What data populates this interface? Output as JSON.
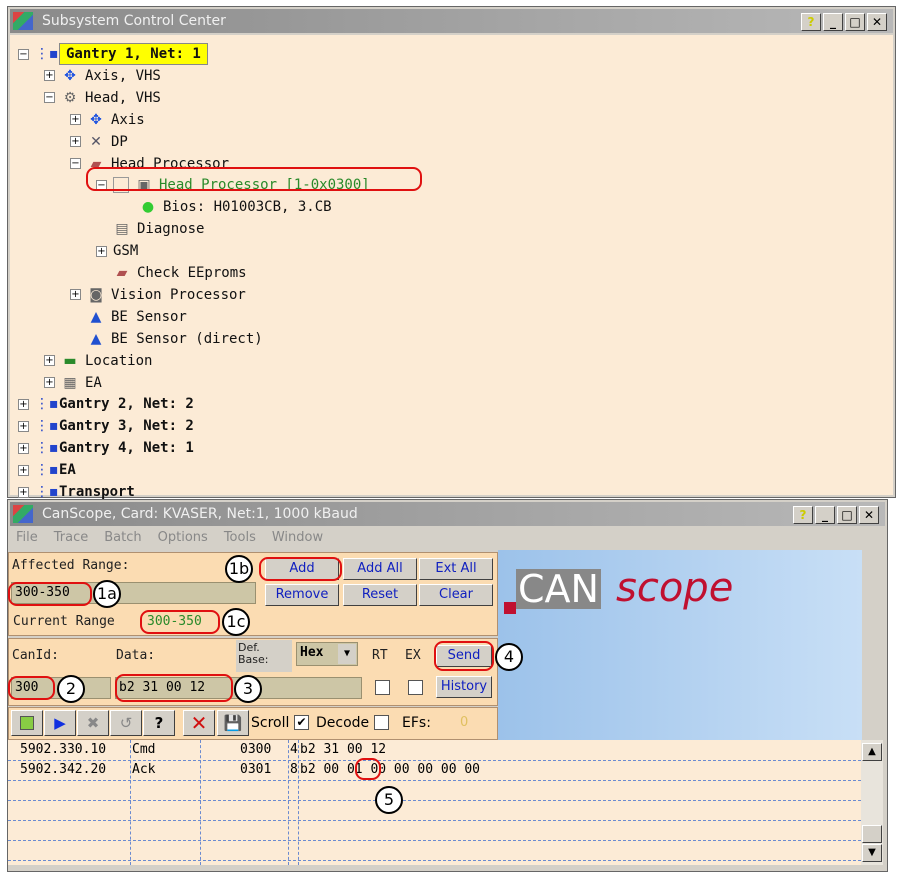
{
  "top_window": {
    "title": "Subsystem Control Center",
    "tree": [
      {
        "label": "Gantry 1, Net: 1",
        "level": 0,
        "expander": "-",
        "icon": "network-icon",
        "style": "highlight"
      },
      {
        "label": "Axis, VHS",
        "level": 1,
        "expander": "+",
        "icon": "axis-icon"
      },
      {
        "label": "Head, VHS",
        "level": 1,
        "expander": "-",
        "icon": "head-icon"
      },
      {
        "label": "Axis",
        "level": 2,
        "expander": "+",
        "icon": "axis-icon"
      },
      {
        "label": "DP",
        "level": 2,
        "expander": "+",
        "icon": "dp-icon"
      },
      {
        "label": "Head Processor",
        "level": 2,
        "expander": "-",
        "icon": "chip-icon"
      },
      {
        "label": "Head Processor [1-0x0300]",
        "level": 3,
        "expander": "-",
        "icon": "processor-icon",
        "style": "green"
      },
      {
        "label": "Bios: H01003CB, 3.CB",
        "level": 4,
        "expander": "",
        "icon": "status-dot-icon"
      },
      {
        "label": "Diagnose",
        "level": 3,
        "expander": "",
        "icon": "diagnose-icon"
      },
      {
        "label": "GSM",
        "level": 3,
        "expander": "+",
        "icon": ""
      },
      {
        "label": "Check EEproms",
        "level": 3,
        "expander": "",
        "icon": "chip-icon"
      },
      {
        "label": "Vision Processor",
        "level": 2,
        "expander": "+",
        "icon": "camera-icon"
      },
      {
        "label": "BE Sensor",
        "level": 2,
        "expander": "",
        "icon": "sensor-icon"
      },
      {
        "label": "BE Sensor (direct)",
        "level": 2,
        "expander": "",
        "icon": "sensor-icon"
      },
      {
        "label": "Location",
        "level": 1,
        "expander": "+",
        "icon": "location-icon"
      },
      {
        "label": "EA",
        "level": 1,
        "expander": "+",
        "icon": "grid-icon"
      },
      {
        "label": "Gantry 2, Net: 2",
        "level": 0,
        "expander": "+",
        "icon": "network-icon",
        "style": "bold"
      },
      {
        "label": "Gantry 3, Net: 2",
        "level": 0,
        "expander": "+",
        "icon": "network-icon",
        "style": "bold"
      },
      {
        "label": "Gantry 4, Net: 1",
        "level": 0,
        "expander": "+",
        "icon": "network-icon",
        "style": "bold"
      },
      {
        "label": "EA",
        "level": 0,
        "expander": "+",
        "icon": "network-icon",
        "style": "bold"
      },
      {
        "label": "Transport",
        "level": 0,
        "expander": "+",
        "icon": "network-icon",
        "style": "bold"
      }
    ]
  },
  "can_window": {
    "title": "CanScope, Card: KVASER, Net:1, 1000 kBaud",
    "menu": [
      "File",
      "Trace",
      "Batch",
      "Options",
      "Tools",
      "Window"
    ],
    "affected_range_label": "Affected Range:",
    "affected_range_value": "300-350",
    "current_range_label": "Current Range",
    "current_range_value": "300-350",
    "buttons": {
      "add": "Add",
      "add_all": "Add All",
      "ext_all": "Ext All",
      "remove": "Remove",
      "reset": "Reset",
      "clear": "Clear",
      "send": "Send",
      "history": "History"
    },
    "canid_label": "CanId:",
    "canid_value": "300",
    "data_label": "Data:",
    "data_value": "b2 31 00 12",
    "def_base_label": "Def. Base:",
    "def_base_value": "Hex",
    "rt_label": "RT",
    "ex_label": "EX",
    "scroll_label": "Scroll",
    "scroll_checked": true,
    "decode_label": "Decode",
    "decode_checked": false,
    "efs_label": "EFs:",
    "efs_value": "0",
    "logo": {
      "part1": "CAN",
      "part2": "scope"
    },
    "log": [
      {
        "time": "5902.330.10",
        "type": "Cmd",
        "id": "0300",
        "len": "4",
        "data": "b2 31 00 12"
      },
      {
        "time": "5902.342.20",
        "type": "Ack",
        "id": "0301",
        "len": "8",
        "data": "b2 00 01 00 00 00 00 00"
      }
    ]
  },
  "callouts": [
    "1a",
    "1b",
    "1c",
    "2",
    "3",
    "4",
    "5"
  ],
  "colors": {
    "tree_bg": "#fcebd6",
    "panel_bg": "#fbdcb2",
    "highlight": "#ffff00",
    "annotation": "#e01010",
    "button_text": "#1020c0"
  }
}
